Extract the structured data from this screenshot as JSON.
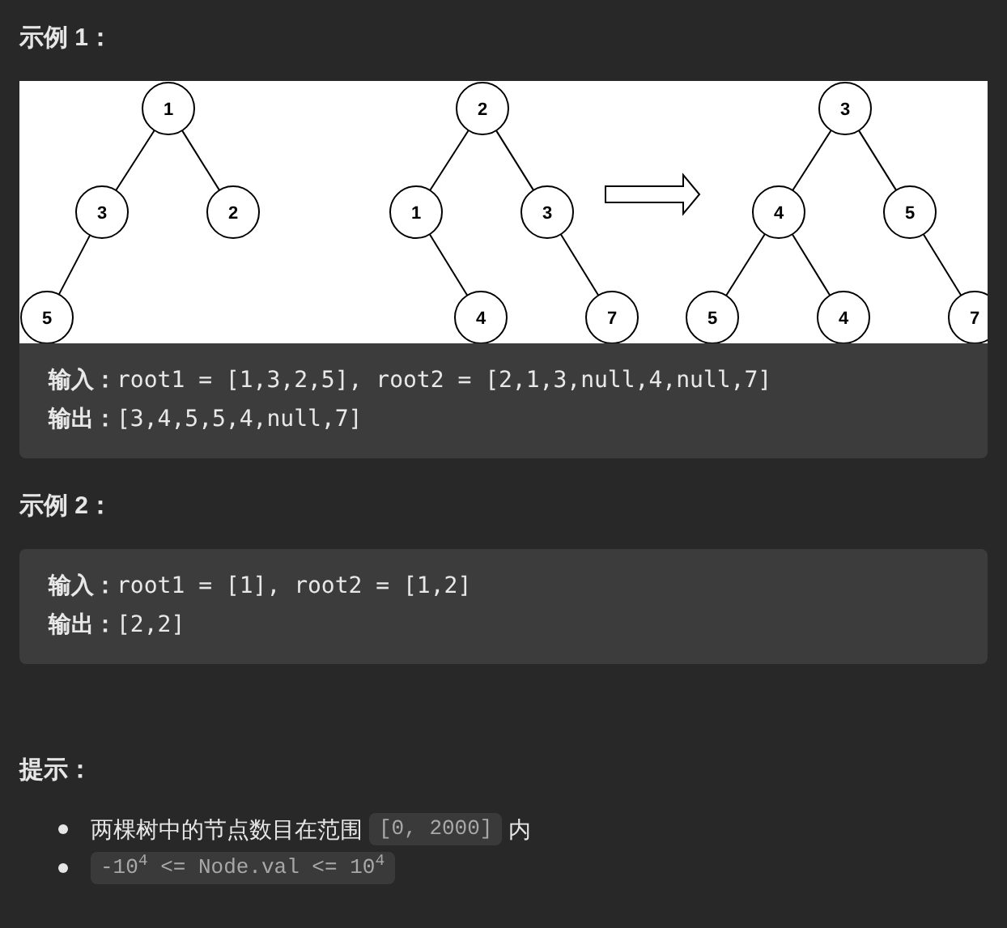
{
  "examples": [
    {
      "heading": "示例 1：",
      "figure": {
        "trees": [
          {
            "value": "1",
            "children": [
              {
                "value": "3",
                "kind": "left",
                "children": [
                  {
                    "value": "5",
                    "kind": "left"
                  }
                ]
              },
              {
                "value": "2",
                "kind": "right"
              }
            ]
          },
          {
            "value": "2",
            "children": [
              {
                "value": "1",
                "kind": "left",
                "children": [
                  {
                    "value": "4",
                    "kind": "right"
                  }
                ]
              },
              {
                "value": "3",
                "kind": "right",
                "children": [
                  {
                    "value": "7",
                    "kind": "right"
                  }
                ]
              }
            ]
          },
          {
            "value": "3",
            "children": [
              {
                "value": "4",
                "kind": "left",
                "children": [
                  {
                    "value": "5",
                    "kind": "left"
                  },
                  {
                    "value": "4",
                    "kind": "right"
                  }
                ]
              },
              {
                "value": "5",
                "kind": "right",
                "children": [
                  {
                    "value": "7",
                    "kind": "right"
                  }
                ]
              }
            ]
          }
        ]
      },
      "lines": [
        "**输入：**root1 = [1,3,2,5], root2 = [2,1,3,null,4,null,7]",
        "**输出：**[3,4,5,5,4,null,7]"
      ]
    },
    {
      "heading": "示例 2：",
      "lines": [
        "**输入：**root1 = [1], root2 = [1,2]",
        "**输出：**[2,2]"
      ]
    }
  ],
  "constraints": {
    "heading": "提示：",
    "items": [
      [
        {
          "kind": "text",
          "text": "两棵树中的节点数目在范围"
        },
        {
          "kind": "code",
          "text": "[0, 2000]"
        },
        {
          "kind": "text",
          "text": "内"
        }
      ],
      [
        {
          "kind": "code",
          "text": "-10$^{4}$ <= Node.val <= 10$^{4}$"
        }
      ]
    ]
  }
}
